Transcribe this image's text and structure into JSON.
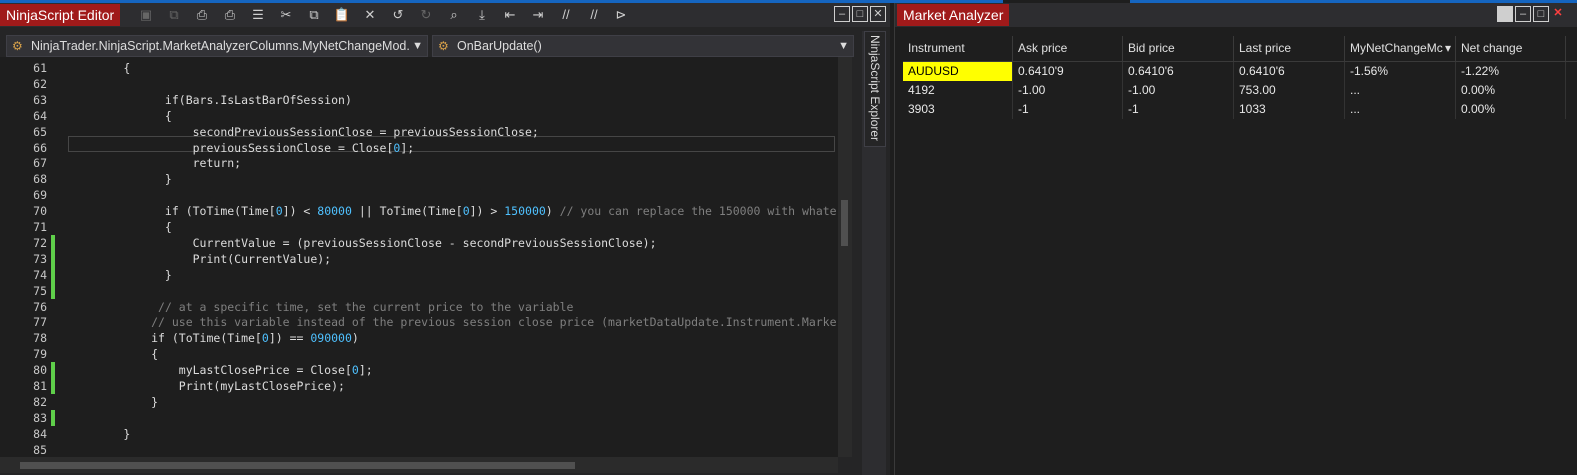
{
  "editor": {
    "title": "NinjaScript Editor",
    "class_combo": "NinjaTrader.NinjaScript.MarketAnalyzerColumns.MyNetChangeMod...",
    "method_combo": "OnBarUpdate()",
    "side_tab": "NinjaScript Explorer",
    "lines": [
      {
        "n": "61",
        "text": "        {"
      },
      {
        "n": "62",
        "text": ""
      },
      {
        "n": "63",
        "text": "              if(Bars.IsLastBarOfSession)"
      },
      {
        "n": "64",
        "text": "              {"
      },
      {
        "n": "65",
        "text": "                  secondPreviousSessionClose = previousSessionClose;"
      },
      {
        "n": "66",
        "text": "                  previousSessionClose = Close[0];"
      },
      {
        "n": "67",
        "text": "                  return;"
      },
      {
        "n": "68",
        "text": "              }"
      },
      {
        "n": "69",
        "text": ""
      },
      {
        "n": "70",
        "text": "              if (ToTime(Time[0]) < 80000 || ToTime(Time[0]) > 150000) // you can replace the 150000 with whate"
      },
      {
        "n": "71",
        "text": "              {"
      },
      {
        "n": "72",
        "text": "                  CurrentValue = (previousSessionClose - secondPreviousSessionClose);"
      },
      {
        "n": "73",
        "text": "                  Print(CurrentValue);"
      },
      {
        "n": "74",
        "text": "              }"
      },
      {
        "n": "75",
        "text": ""
      },
      {
        "n": "76",
        "text": "             // at a specific time, set the current price to the variable"
      },
      {
        "n": "77",
        "text": "            // use this variable instead of the previous session close price (marketDataUpdate.Instrument.Marke"
      },
      {
        "n": "78",
        "text": "            if (ToTime(Time[0]) == 090000)"
      },
      {
        "n": "79",
        "text": "            {"
      },
      {
        "n": "80",
        "text": "                myLastClosePrice = Close[0];"
      },
      {
        "n": "81",
        "text": "                Print(myLastClosePrice);"
      },
      {
        "n": "82",
        "text": "            }"
      },
      {
        "n": "83",
        "text": ""
      },
      {
        "n": "84",
        "text": "        }"
      },
      {
        "n": "85",
        "text": ""
      }
    ]
  },
  "analyzer": {
    "title": "Market Analyzer",
    "columns": [
      "Instrument",
      "Ask price",
      "Bid price",
      "Last price",
      "MyNetChangeMc",
      "Net change"
    ],
    "rows": [
      [
        "AUDUSD",
        "0.6410'9",
        "0.6410'6",
        "0.6410'6",
        "-1.56%",
        "-1.22%"
      ],
      [
        "4192",
        "-1.00",
        "-1.00",
        "753.00",
        "...",
        "0.00%"
      ],
      [
        "3903",
        "-1",
        "-1",
        "1033",
        "...",
        "0.00%"
      ]
    ]
  },
  "colors": {
    "accent_tab": "#a01a1a",
    "highlight": "#ffff00",
    "change_marker": "#5fcf4a",
    "number": "#4fc1ff"
  }
}
